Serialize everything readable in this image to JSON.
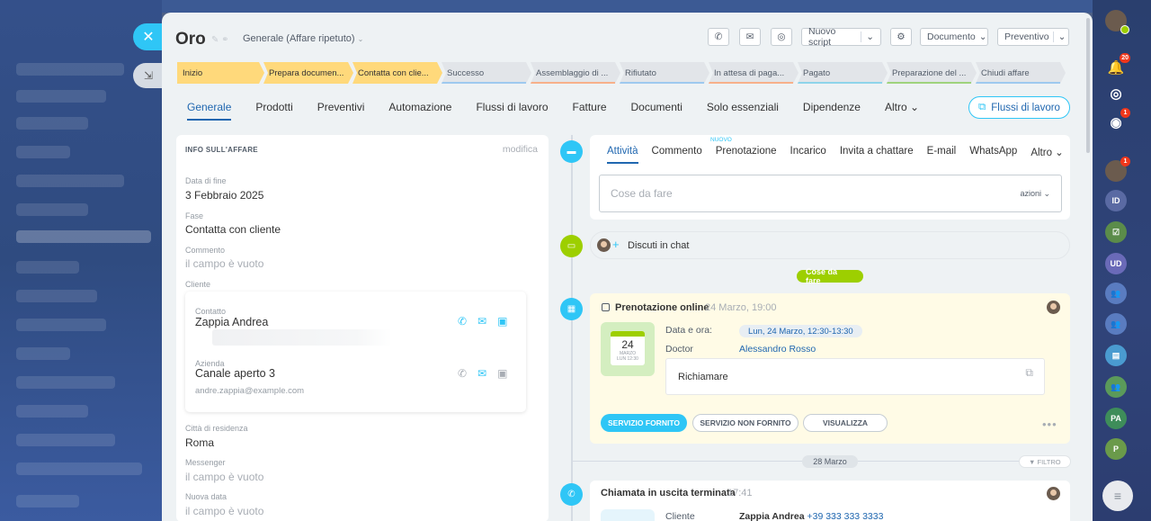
{
  "deal": {
    "title": "Oro",
    "category": "Generale (Affare ripetuto)"
  },
  "header_buttons": {
    "script": "Nuovo script",
    "document": "Documento",
    "quote": "Preventivo"
  },
  "stages": [
    {
      "label": "Inizio",
      "done": true
    },
    {
      "label": "Prepara documen...",
      "done": true
    },
    {
      "label": "Contatta con clie...",
      "done": true
    },
    {
      "label": "Successo",
      "done": false,
      "color": "#9ec9ef"
    },
    {
      "label": "Assemblaggio di ...",
      "done": false,
      "color": "#f7b08a"
    },
    {
      "label": "Rifiutato",
      "done": false,
      "color": "#9ec9ef"
    },
    {
      "label": "In attesa di paga...",
      "done": false,
      "color": "#f7b08a"
    },
    {
      "label": "Pagato",
      "done": false,
      "color": "#8ed4ea"
    },
    {
      "label": "Preparazione del ...",
      "done": false,
      "color": "#9fd37d"
    },
    {
      "label": "Chiudi affare",
      "done": false,
      "color": "#9ec9ef"
    }
  ],
  "tabs": [
    "Generale",
    "Prodotti",
    "Preventivi",
    "Automazione",
    "Flussi di lavoro",
    "Fatture",
    "Documenti",
    "Solo essenziali",
    "Dipendenze",
    "Altro"
  ],
  "workflows_button": "Flussi di lavoro",
  "info": {
    "heading": "INFO SULL'AFFARE",
    "edit": "modifica",
    "end_date_label": "Data di fine",
    "end_date": "3 Febbraio 2025",
    "stage_label": "Fase",
    "stage": "Contatta con cliente",
    "comment_label": "Commento",
    "empty": "il campo è vuoto",
    "client_label": "Cliente",
    "contact_label": "Contatto",
    "contact_name": "Zappia Andrea",
    "company_label": "Azienda",
    "company_name": "Canale aperto 3",
    "company_email": "andre.zappia@example.com",
    "city_label": "Città di residenza",
    "city": "Roma",
    "messenger_label": "Messenger",
    "newdate_label": "Nuova data"
  },
  "timeline": {
    "tabs": [
      "Attività",
      "Commento",
      "Prenotazione",
      "Incarico",
      "Invita a chattare",
      "E-mail",
      "WhatsApp",
      "Altro"
    ],
    "new_badge": "NUOVO",
    "todo_placeholder": "Cose da fare",
    "actions": "azioni",
    "chat": "Discuti in chat",
    "todo_pill": "Cose da fare",
    "booking": {
      "title": "Prenotazione online",
      "date": "24 Marzo, 19:00",
      "day": "24",
      "month": "MARZO",
      "sub": "LUN 12:30",
      "date_label": "Data e ora:",
      "date_value": "Lun, 24 Marzo, 12:30-13:30",
      "doctor_label": "Doctor",
      "doctor": "Alessandro Rosso",
      "note": "Richiamare",
      "btn_done": "SERVIZIO FORNITO",
      "btn_not": "SERVIZIO NON FORNITO",
      "btn_view": "VISUALIZZA"
    },
    "date_pill": "28 Marzo",
    "filter": "FILTRO",
    "call": {
      "title": "Chiamata in uscita terminata",
      "time": "17:41",
      "client_label": "Cliente",
      "client": "Zappia Andrea",
      "phone": "+39 333 333 3333"
    }
  },
  "right_bar": {
    "notif_badge": "20",
    "chat_badge": "1",
    "avatar_badge": "1",
    "initials_1": "ID",
    "initials_2": "UD",
    "initials_3": "PA",
    "initials_4": "P"
  }
}
